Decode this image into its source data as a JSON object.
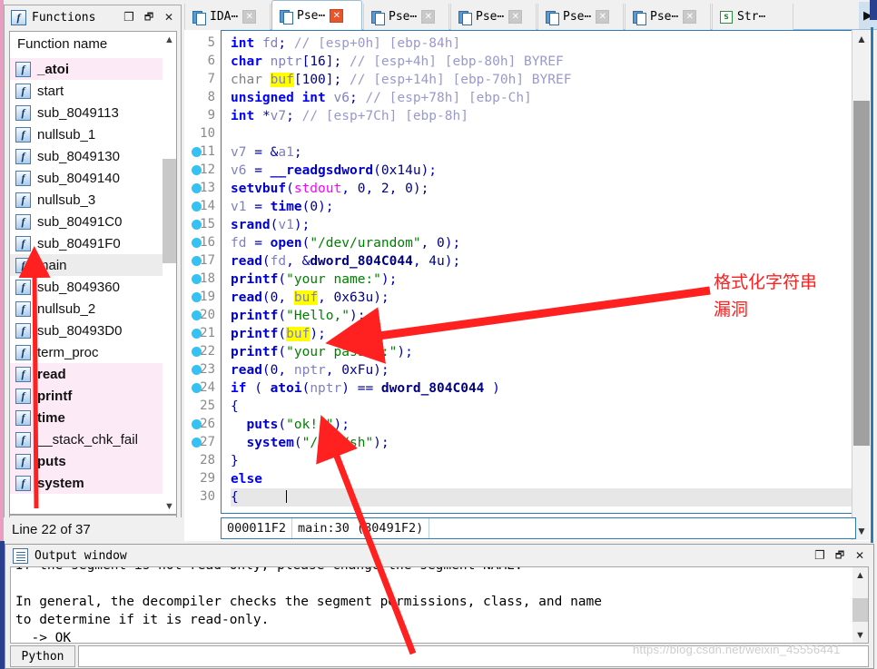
{
  "functions_panel": {
    "title": "Functions",
    "column_header": "Function name",
    "status": "Line 22 of 37",
    "window_buttons": {
      "maximize": "❐",
      "restore": "🗗",
      "close": "✕"
    },
    "items": [
      {
        "label": "_atoi",
        "state": "pink-selected",
        "bold": true
      },
      {
        "label": "start",
        "state": "normal",
        "bold": false
      },
      {
        "label": "sub_8049113",
        "state": "normal",
        "bold": false
      },
      {
        "label": "nullsub_1",
        "state": "normal",
        "bold": false
      },
      {
        "label": "sub_8049130",
        "state": "normal",
        "bold": false
      },
      {
        "label": "sub_8049140",
        "state": "normal",
        "bold": false
      },
      {
        "label": "nullsub_3",
        "state": "normal",
        "bold": false
      },
      {
        "label": "sub_80491C0",
        "state": "normal",
        "bold": false
      },
      {
        "label": "sub_80491F0",
        "state": "normal",
        "bold": false
      },
      {
        "label": "main",
        "state": "grey-current",
        "bold": false
      },
      {
        "label": "sub_8049360",
        "state": "normal",
        "bold": false
      },
      {
        "label": "nullsub_2",
        "state": "normal",
        "bold": false
      },
      {
        "label": "sub_80493D0",
        "state": "normal",
        "bold": false
      },
      {
        "label": "term_proc",
        "state": "normal",
        "bold": false
      },
      {
        "label": "read",
        "state": "pink",
        "bold": true
      },
      {
        "label": "printf",
        "state": "pink",
        "bold": true
      },
      {
        "label": "time",
        "state": "pink",
        "bold": true
      },
      {
        "label": "__stack_chk_fail",
        "state": "pink",
        "bold": false
      },
      {
        "label": "puts",
        "state": "pink",
        "bold": true
      },
      {
        "label": "system",
        "state": "pink",
        "bold": true
      }
    ]
  },
  "tabs": [
    {
      "label": "IDA⋯",
      "icon": "document-icon",
      "active": false,
      "close_style": "grey"
    },
    {
      "label": "Pse⋯",
      "icon": "document-icon",
      "active": true,
      "close_style": "red"
    },
    {
      "label": "Pse⋯",
      "icon": "document-icon",
      "active": false,
      "close_style": "grey"
    },
    {
      "label": "Pse⋯",
      "icon": "document-icon",
      "active": false,
      "close_style": "grey"
    },
    {
      "label": "Pse⋯",
      "icon": "document-icon",
      "active": false,
      "close_style": "grey"
    },
    {
      "label": "Pse⋯",
      "icon": "document-icon",
      "active": false,
      "close_style": "grey"
    },
    {
      "label": "Str⋯",
      "icon": "strings-icon",
      "active": false,
      "close_style": "none"
    }
  ],
  "tab_scroll_right": "▶",
  "code": {
    "first_line": 5,
    "breakpoint_lines": [
      11,
      12,
      13,
      14,
      15,
      16,
      17,
      18,
      19,
      20,
      21,
      22,
      23,
      24,
      26,
      27
    ],
    "current_line": 30,
    "lines": [
      {
        "n": 5,
        "text": "int fd; // [esp+0h] [ebp-84h]"
      },
      {
        "n": 6,
        "text": "char nptr[16]; // [esp+4h] [ebp-80h] BYREF"
      },
      {
        "n": 7,
        "text": "char buf[100]; // [esp+14h] [ebp-70h] BYREF"
      },
      {
        "n": 8,
        "text": "unsigned int v6; // [esp+78h] [ebp-Ch]"
      },
      {
        "n": 9,
        "text": "int *v7; // [esp+7Ch] [ebp-8h]"
      },
      {
        "n": 10,
        "text": ""
      },
      {
        "n": 11,
        "text": "v7 = &a1;"
      },
      {
        "n": 12,
        "text": "v6 = __readgsdword(0x14u);"
      },
      {
        "n": 13,
        "text": "setvbuf(stdout, 0, 2, 0);"
      },
      {
        "n": 14,
        "text": "v1 = time(0);"
      },
      {
        "n": 15,
        "text": "srand(v1);"
      },
      {
        "n": 16,
        "text": "fd = open(\"/dev/urandom\", 0);"
      },
      {
        "n": 17,
        "text": "read(fd, &dword_804C044, 4u);"
      },
      {
        "n": 18,
        "text": "printf(\"your name:\");"
      },
      {
        "n": 19,
        "text": "read(0, buf, 0x63u);"
      },
      {
        "n": 20,
        "text": "printf(\"Hello,\");"
      },
      {
        "n": 21,
        "text": "printf(buf);"
      },
      {
        "n": 22,
        "text": "printf(\"your passwd:\");"
      },
      {
        "n": 23,
        "text": "read(0, nptr, 0xFu);"
      },
      {
        "n": 24,
        "text": "if ( atoi(nptr) == dword_804C044 )"
      },
      {
        "n": 25,
        "text": "{"
      },
      {
        "n": 26,
        "text": "  puts(\"ok!!\");"
      },
      {
        "n": 27,
        "text": "  system(\"/bin/sh\");"
      },
      {
        "n": 28,
        "text": "}"
      },
      {
        "n": 29,
        "text": "else"
      },
      {
        "n": 30,
        "text": "{"
      }
    ],
    "status_segments": [
      "000011F2",
      "main:30  (80491F2)",
      ""
    ]
  },
  "output_window": {
    "title": "Output window",
    "window_buttons": {
      "maximize": "❐",
      "restore": "🗗",
      "close": "✕"
    },
    "lines": [
      "If the segment is not read-only, please change the segment NAME.",
      "",
      "In general, the decompiler checks the segment permissions, class, and name",
      "to determine if it is read-only.",
      "  -> OK"
    ],
    "python_button": "Python",
    "input_value": ""
  },
  "annotations": {
    "note_line1": "格式化字符串",
    "note_line2": "漏洞",
    "color": "#ff2020"
  },
  "watermark": "https://blog.csdn.net/weixin_45556441"
}
